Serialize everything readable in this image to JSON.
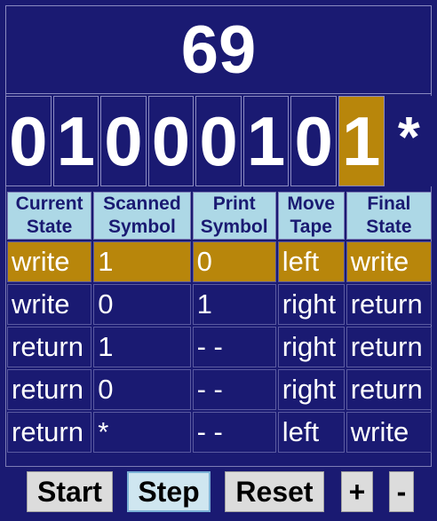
{
  "counter": "69",
  "tape": [
    "0",
    "1",
    "0",
    "0",
    "0",
    "1",
    "0",
    "1",
    "*"
  ],
  "head_index": 7,
  "table": {
    "headers": [
      [
        "Current",
        "State"
      ],
      [
        "Scanned",
        "Symbol"
      ],
      [
        "Print",
        "Symbol"
      ],
      [
        "Move",
        "Tape"
      ],
      [
        "Final",
        "State"
      ]
    ],
    "rows": [
      [
        "write",
        "1",
        "0",
        "left",
        "write"
      ],
      [
        "write",
        "0",
        "1",
        "right",
        "return"
      ],
      [
        "return",
        "1",
        "- -",
        "right",
        "return"
      ],
      [
        "return",
        "0",
        "- -",
        "right",
        "return"
      ],
      [
        "return",
        "*",
        "- -",
        "left",
        "write"
      ]
    ],
    "active_row": 0
  },
  "buttons": {
    "start": "Start",
    "step": "Step",
    "reset": "Reset",
    "plus": "+",
    "minus": "-"
  },
  "colors": {
    "background": "#1a1a72",
    "highlight": "#b8860b",
    "header": "#add8e6"
  }
}
